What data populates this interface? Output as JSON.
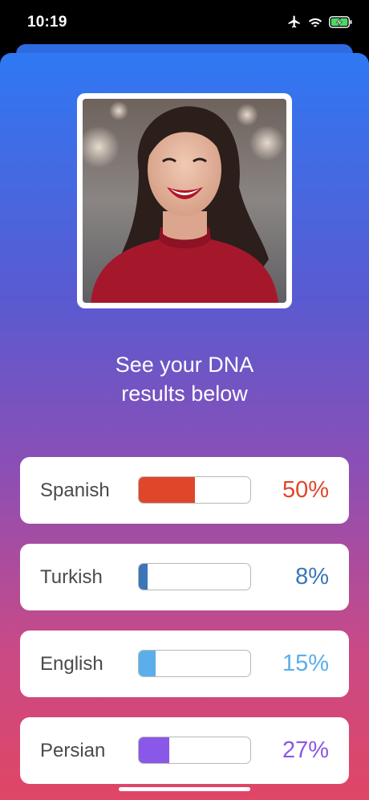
{
  "status_bar": {
    "time": "10:19",
    "icons": [
      "airplane-icon",
      "wifi-icon",
      "battery-charging-icon"
    ]
  },
  "headline": {
    "line1": "See your DNA",
    "line2": "results below"
  },
  "results": [
    {
      "label": "Spanish",
      "percent_text": "50%",
      "fraction": 0.5,
      "color": "#e0462a"
    },
    {
      "label": "Turkish",
      "percent_text": "8%",
      "fraction": 0.08,
      "color": "#3a76b8"
    },
    {
      "label": "English",
      "percent_text": "15%",
      "fraction": 0.15,
      "color": "#5aaeea"
    },
    {
      "label": "Persian",
      "percent_text": "27%",
      "fraction": 0.27,
      "color": "#8a58e8"
    }
  ],
  "colors": {
    "gradient_top": "#2f78f3",
    "gradient_bottom": "#e04665"
  }
}
